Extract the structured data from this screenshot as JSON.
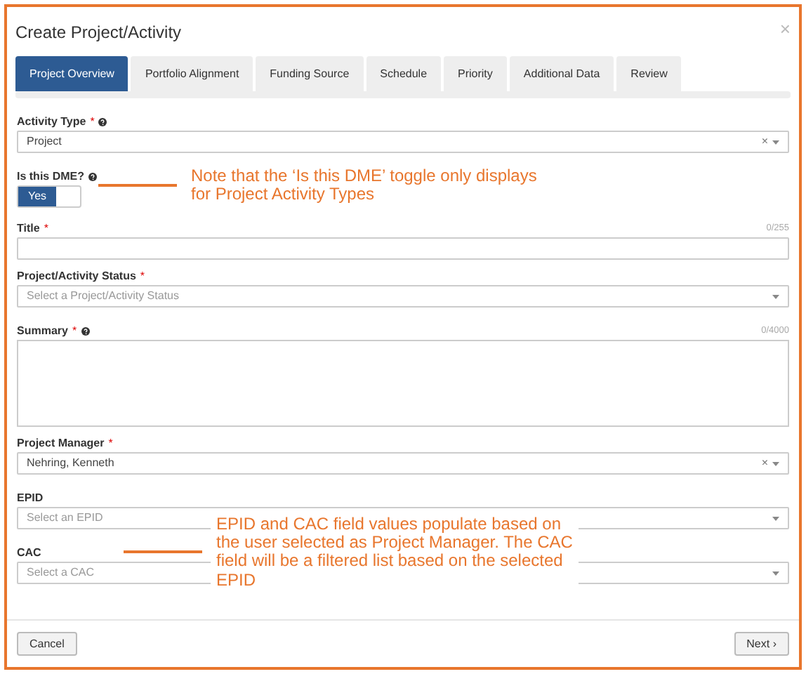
{
  "dialog": {
    "title": "Create Project/Activity",
    "close": "×"
  },
  "tabs": [
    {
      "label": "Project Overview",
      "selected": true
    },
    {
      "label": "Portfolio Alignment",
      "selected": false
    },
    {
      "label": "Funding Source",
      "selected": false
    },
    {
      "label": "Schedule",
      "selected": false
    },
    {
      "label": "Priority",
      "selected": false
    },
    {
      "label": "Additional Data",
      "selected": false
    },
    {
      "label": "Review",
      "selected": false
    }
  ],
  "fields": [
    {
      "kind": "select",
      "label": "Activity Type",
      "required_mark": "*",
      "help": true,
      "value": "Project",
      "clear": "×"
    },
    {
      "kind": "toggle",
      "label": "Is this DME?",
      "help": true,
      "on_label": "Yes",
      "on": true
    },
    {
      "kind": "text",
      "label": "Title",
      "required_mark": "*",
      "help": false,
      "counter": "0/255"
    },
    {
      "kind": "select",
      "label": "Project/Activity Status",
      "required_mark": "*",
      "help": false,
      "placeholder": "Select a Project/Activity Status"
    },
    {
      "kind": "textarea",
      "label": "Summary",
      "required_mark": "*",
      "help": true,
      "counter": "0/4000"
    },
    {
      "kind": "select",
      "label": "Project Manager",
      "required_mark": "*",
      "help": false,
      "value": "Nehring, Kenneth",
      "clear": "×"
    },
    {
      "kind": "select",
      "label": "EPID",
      "help": false,
      "placeholder": "Select an EPID"
    },
    {
      "kind": "select",
      "label": "CAC",
      "help": false,
      "placeholder": "Select a CAC"
    }
  ],
  "annotations": [
    {
      "text": "Note that the ‘Is this DME’ toggle only displays for Project Activity Types"
    },
    {
      "text": "EPID and CAC field values populate based on the user selected as Project Manager. The CAC field will be a filtered list based on the selected EPID"
    }
  ],
  "footer": {
    "cancel": "Cancel",
    "next": "Next ›"
  }
}
